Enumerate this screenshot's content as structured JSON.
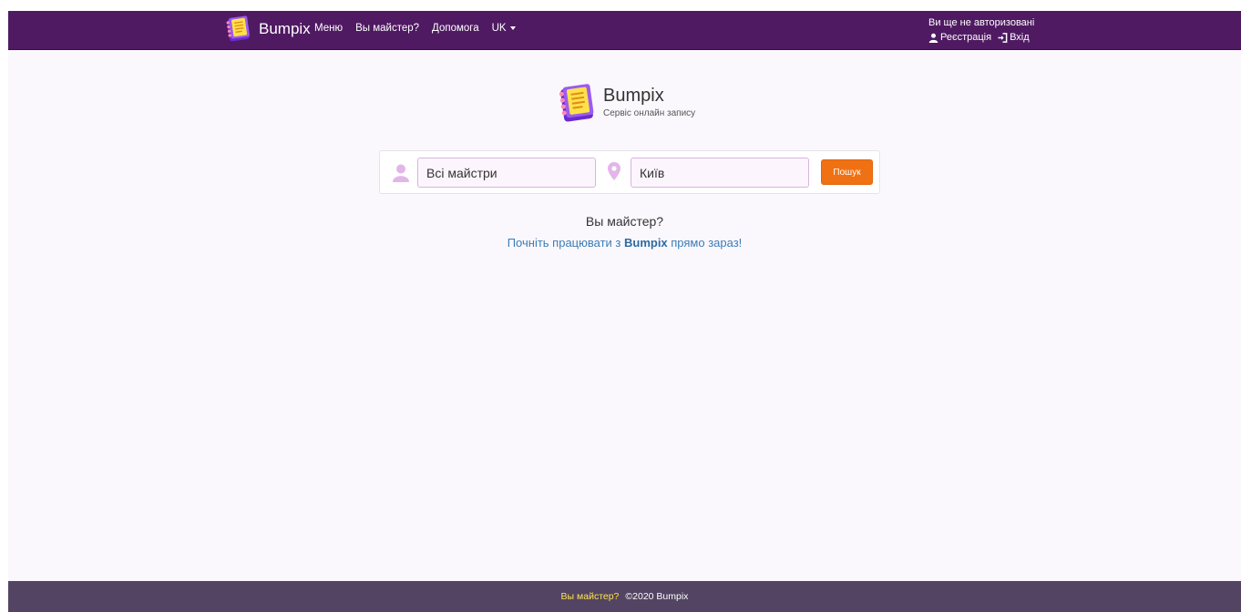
{
  "navbar": {
    "brand": "Bumpix",
    "menu": [
      {
        "label": "Меню"
      },
      {
        "label": "Вы майстер?"
      },
      {
        "label": "Допомога"
      }
    ],
    "language": "UK",
    "auth_status": "Ви ще не авторизовані",
    "register_label": "Реєстрація",
    "login_label": "Вхід"
  },
  "hero": {
    "title": "Bumpix",
    "subtitle": "Сервіс онлайн запису"
  },
  "search": {
    "master_value": "Всі майстри",
    "city_value": "Київ",
    "button_label": "Пошук"
  },
  "promo": {
    "question": "Вы майстер?",
    "link_prefix": "Почніть працювати з ",
    "link_brand": "Bumpix",
    "link_suffix": " прямо зараз!"
  },
  "footer": {
    "master_link": "Вы майстер?",
    "copyright": "©2020 Bumpix"
  },
  "colors": {
    "navbar_bg": "#4f1a62",
    "page_bg": "#fbf8fd",
    "footer_bg": "#524462",
    "accent_button": "#f07113",
    "link": "#3b7db5",
    "footer_link": "#ffe44d"
  }
}
